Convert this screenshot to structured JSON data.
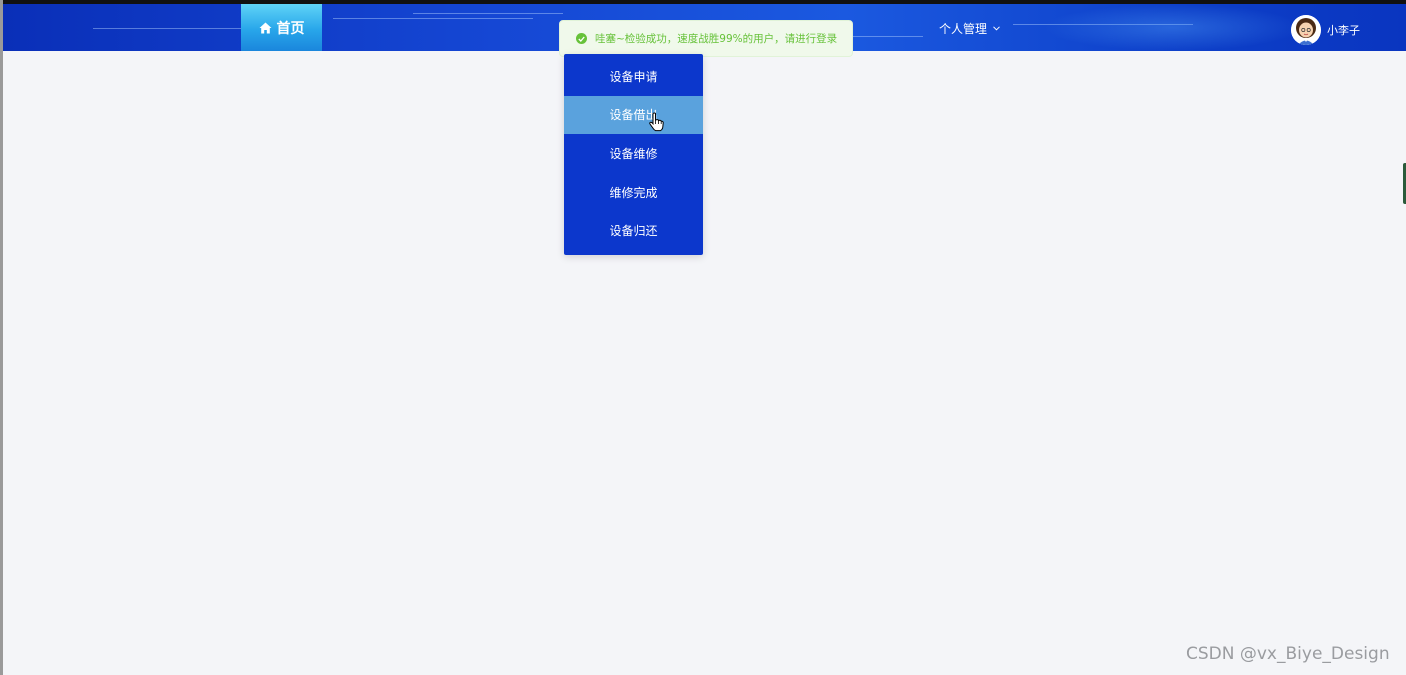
{
  "nav": {
    "home_label": "首页",
    "personal_label": "个人管理",
    "username": "小李子"
  },
  "toast": {
    "message": "哇塞~检验成功，速度战胜99%的用户，请进行登录",
    "color": "#67c23a"
  },
  "dropdown": {
    "items": [
      {
        "label": "设备申请"
      },
      {
        "label": "设备借出"
      },
      {
        "label": "设备维修"
      },
      {
        "label": "维修完成"
      },
      {
        "label": "设备归还"
      }
    ],
    "active_index": 1
  },
  "watermark": "CSDN @vx_Biye_Design",
  "colors": {
    "header": "#1547d4",
    "nav_active": "#28a6ea",
    "dropdown_bg": "#0c37cc",
    "dropdown_hover": "#5aa2dd",
    "page_bg": "#f4f5f8"
  }
}
